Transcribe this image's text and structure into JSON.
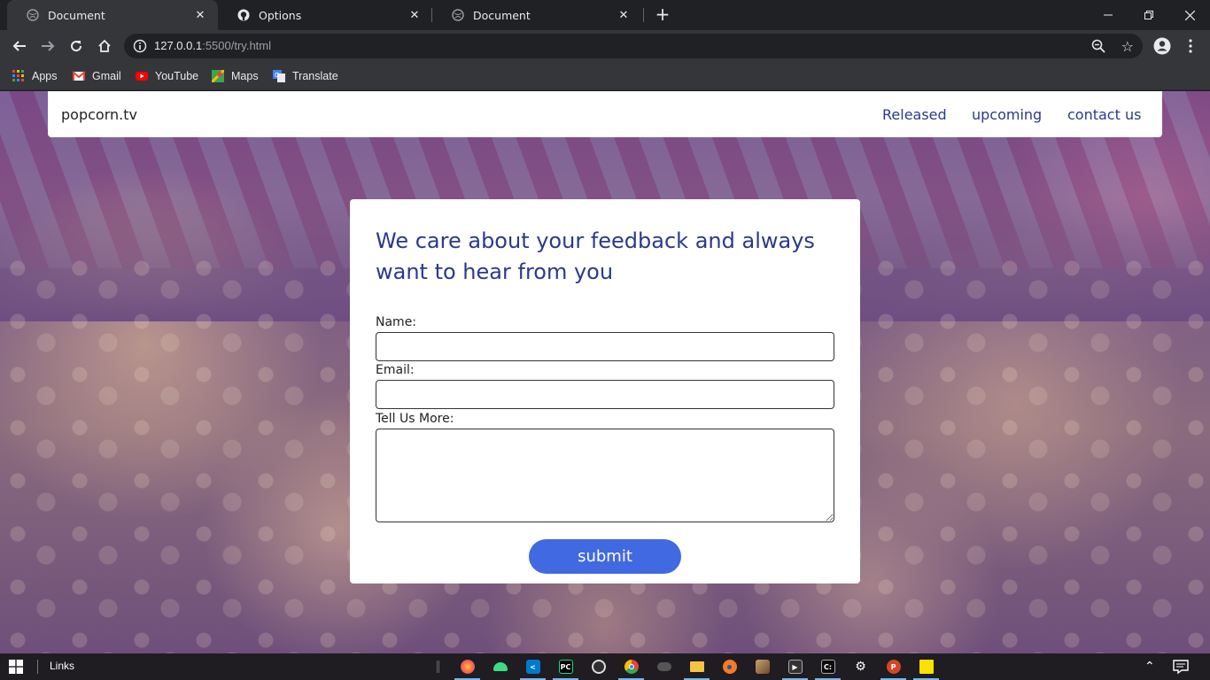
{
  "browser": {
    "tabs": [
      {
        "title": "Document",
        "active": true,
        "icon": "globe-icon"
      },
      {
        "title": "Options",
        "active": false,
        "icon": "github-icon"
      },
      {
        "title": "Document",
        "active": false,
        "icon": "globe-icon"
      }
    ],
    "tab_close_glyph": "✕",
    "new_tab_glyph": "+",
    "url_host": "127.0.0.1",
    "url_rest": ":5500/try.html",
    "bookmarks": [
      {
        "label": "Apps",
        "icon": "apps-grid-icon"
      },
      {
        "label": "Gmail",
        "icon": "gmail-icon"
      },
      {
        "label": "YouTube",
        "icon": "youtube-icon"
      },
      {
        "label": "Maps",
        "icon": "maps-icon"
      },
      {
        "label": "Translate",
        "icon": "translate-icon"
      }
    ]
  },
  "site": {
    "brand": "popcorn.tv",
    "nav": [
      "Released",
      "upcoming",
      "contact us"
    ],
    "form": {
      "title": "We care about your feedback and always want to hear from you",
      "name_label": "Name:",
      "name_value": "",
      "email_label": "Email:",
      "email_value": "",
      "more_label": "Tell Us More:",
      "more_value": "",
      "submit_label": "submit"
    }
  },
  "taskbar": {
    "links_label": "Links",
    "apps": [
      {
        "name": "firefox",
        "open": true
      },
      {
        "name": "android-studio",
        "open": false
      },
      {
        "name": "vscode",
        "open": true
      },
      {
        "name": "pycharm",
        "open": true
      },
      {
        "name": "obs",
        "open": false
      },
      {
        "name": "chrome",
        "open": true
      },
      {
        "name": "alien-app",
        "open": false
      },
      {
        "name": "file-explorer",
        "open": true
      },
      {
        "name": "blender",
        "open": false
      },
      {
        "name": "media-app",
        "open": false
      },
      {
        "name": "video-player",
        "open": true
      },
      {
        "name": "terminal",
        "open": true
      },
      {
        "name": "settings",
        "open": false
      },
      {
        "name": "powerpoint",
        "open": true
      },
      {
        "name": "sticky-notes",
        "open": true
      }
    ]
  },
  "colors": {
    "accent_blue": "#4169e1",
    "link_blue": "#2b3a8a",
    "chrome_dark": "#202124",
    "chrome_toolbar": "#35363a"
  }
}
